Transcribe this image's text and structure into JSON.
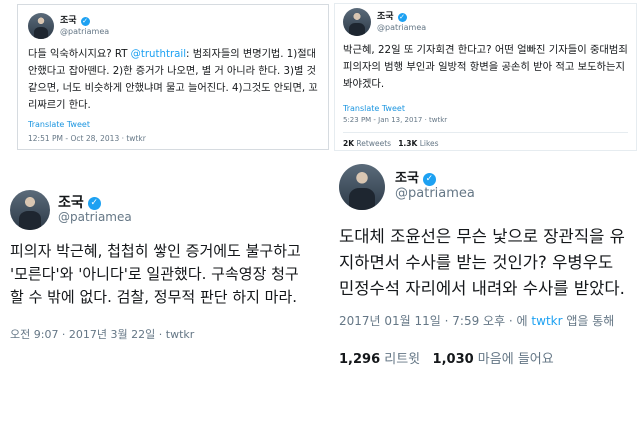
{
  "colors": {
    "accent": "#1da1f2",
    "translate": "#1b95e0",
    "muted": "#657786",
    "text": "#14171a",
    "border": "#e6ecf0"
  },
  "icons": {
    "verified": "verified-badge-icon",
    "avatar": "profile-photo"
  },
  "tweet1": {
    "name": "조국",
    "handle": "@patriamea",
    "text_before_link": "다들 익숙하시지요? RT ",
    "mention": "@truthtrail",
    "text_after_link": ": 범죄자들의 변명기법. 1)절대 안했다고 잡아뗀다. 2)한 증거가 나오면, 별 거 아니라 한다. 3)별 것 같으면, 너도 비슷하게 안했냐며 물고 늘어진다. 4)그것도 안되면, 꼬리짜르기 한다.",
    "translate": "Translate Tweet",
    "meta": "12:51 PM - Oct 28, 2013 · twtkr"
  },
  "tweet2": {
    "name": "조국",
    "handle": "@patriamea",
    "text": "박근혜, 22일 또 기자회견 한다고? 어떤 얼빠진 기자들이 중대범죄 피의자의 범행 부인과 일방적 항변을 공손히 받아 적고 보도하는지 봐야겠다.",
    "translate": "Translate Tweet",
    "meta": "5:23 PM - Jan 13, 2017 · twtkr",
    "retweets_count": "2K",
    "retweets_label": " Retweets",
    "likes_count": "1.3K",
    "likes_label": " Likes"
  },
  "tweet3": {
    "name": "조국",
    "handle": "@patriamea",
    "text": "피의자 박근혜, 첩첩히 쌓인 증거에도 불구하고 '모른다'와 '아니다'로 일관했다. 구속영장 청구할 수 밖에 없다. 검찰, 정무적 판단 하지 마라.",
    "meta": "오전 9:07 · 2017년 3월 22일 · twtkr"
  },
  "tweet4": {
    "name": "조국",
    "handle": "@patriamea",
    "text": "도대체 조윤선은 무슨 낯으로 장관직을 유지하면서 수사를 받는 것인가? 우병우도 민정수석 자리에서 내려와 수사를 받았다.",
    "meta_before_link": "2017년 01월 11일 · 7:59 오후 · 에 ",
    "meta_link": "twtkr",
    "meta_after_link": " 앱을 통해",
    "retweets_count": "1,296",
    "retweets_label": " 리트윗",
    "likes_count": "1,030",
    "likes_label": " 마음에 들어요"
  }
}
